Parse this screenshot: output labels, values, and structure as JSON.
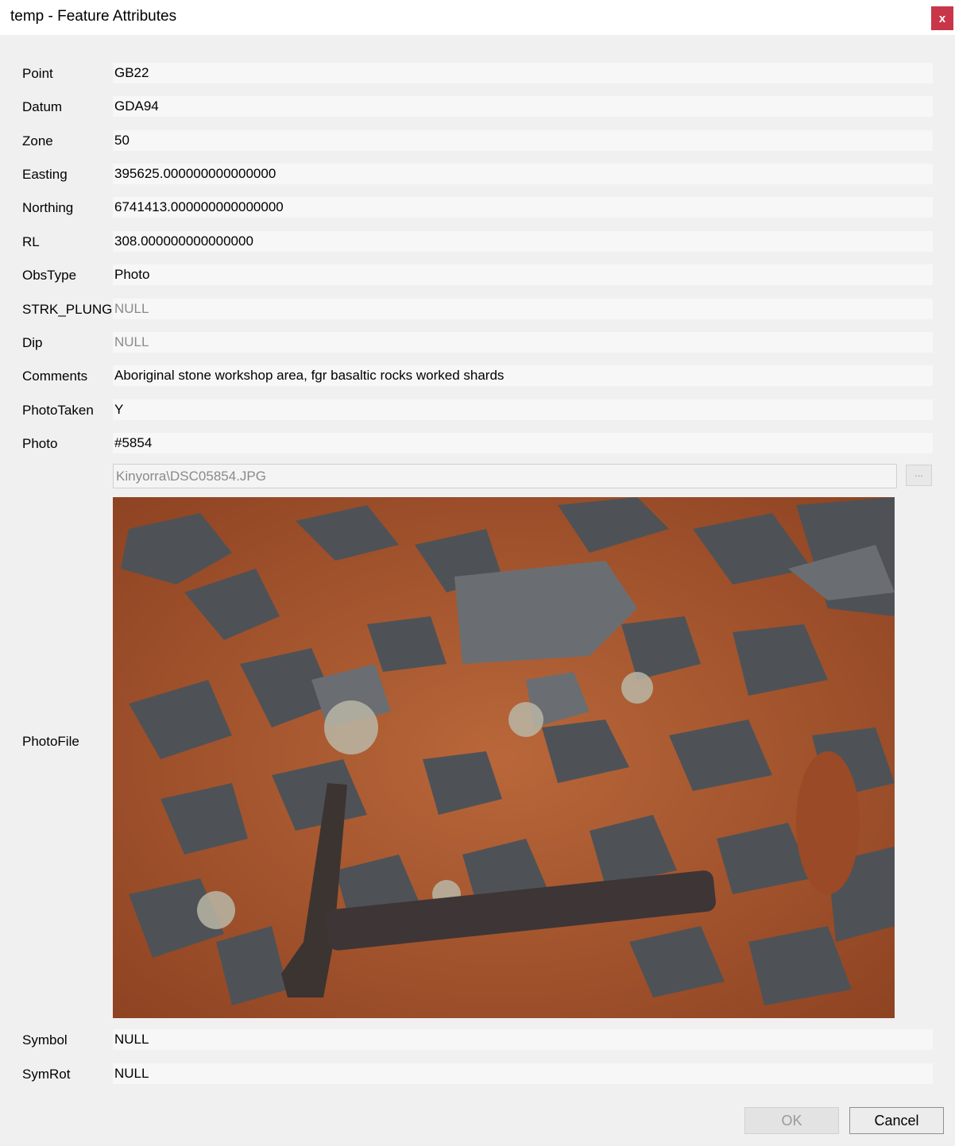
{
  "window": {
    "title": "temp - Feature Attributes",
    "close_label": "x"
  },
  "fields": {
    "point": {
      "label": "Point",
      "value": "GB22"
    },
    "datum": {
      "label": "Datum",
      "value": "GDA94"
    },
    "zone": {
      "label": "Zone",
      "value": "50"
    },
    "easting": {
      "label": "Easting",
      "value": "395625.000000000000000"
    },
    "northing": {
      "label": "Northing",
      "value": "6741413.000000000000000"
    },
    "rl": {
      "label": "RL",
      "value": "308.000000000000000"
    },
    "obstype": {
      "label": "ObsType",
      "value": "Photo"
    },
    "strk_plung": {
      "label": "STRK_PLUNG",
      "value": "NULL"
    },
    "dip": {
      "label": "Dip",
      "value": "NULL"
    },
    "comments": {
      "label": "Comments",
      "value": "Aboriginal stone workshop area, fgr basaltic rocks worked shards"
    },
    "phototaken": {
      "label": "PhotoTaken",
      "value": "Y"
    },
    "photo": {
      "label": "Photo",
      "value": "#5854"
    },
    "photofile": {
      "label": "PhotoFile",
      "path": "Kinyorra\\DSC05854.JPG",
      "browse_label": "..."
    },
    "symbol": {
      "label": "Symbol",
      "value": "NULL"
    },
    "symrot": {
      "label": "SymRot",
      "value": "NULL"
    }
  },
  "buttons": {
    "ok": "OK",
    "cancel": "Cancel"
  }
}
